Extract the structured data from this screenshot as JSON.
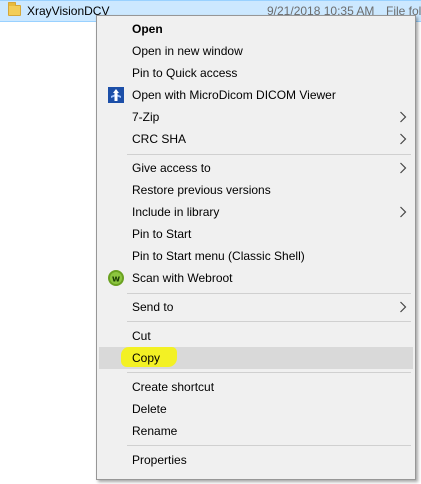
{
  "file": {
    "name": "XrayVisionDCV",
    "date": "9/21/2018 10:35 AM",
    "type": "File fol"
  },
  "menu": {
    "open": "Open",
    "open_new_window": "Open in new window",
    "pin_quick_access": "Pin to Quick access",
    "open_microdicom": "Open with MicroDicom DICOM Viewer",
    "zip": "7-Zip",
    "crc_sha": "CRC SHA",
    "give_access": "Give access to",
    "restore_versions": "Restore previous versions",
    "include_library": "Include in library",
    "pin_start": "Pin to Start",
    "pin_start_classic": "Pin to Start menu (Classic Shell)",
    "scan_webroot": "Scan with Webroot",
    "send_to": "Send to",
    "cut": "Cut",
    "copy": "Copy",
    "create_shortcut": "Create shortcut",
    "delete": "Delete",
    "rename": "Rename",
    "properties": "Properties"
  },
  "colors": {
    "selection_bg": "#cce8ff",
    "menu_bg": "#f0f0f0",
    "hover_bg": "#d9d9d9",
    "highlighter": "#f4f21a",
    "webroot_green": "#6aa121"
  },
  "icons": {
    "folder": "folder-icon",
    "microdicom": "microdicom-icon",
    "webroot": "webroot-icon",
    "submenu": "chevron-right-icon"
  }
}
